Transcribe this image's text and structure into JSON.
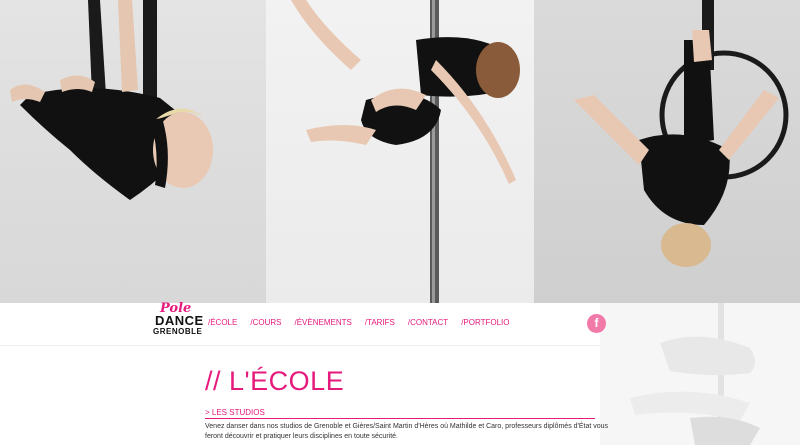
{
  "logo": {
    "word1": "Pole",
    "word2": "DANCE",
    "word3": "GRENOBLE"
  },
  "nav": {
    "items": [
      {
        "label": "/ÉCOLE"
      },
      {
        "label": "/COURS"
      },
      {
        "label": "/ÉVÈNEMENTS"
      },
      {
        "label": "/TARIFS"
      },
      {
        "label": "/CONTACT"
      },
      {
        "label": "/PORTFOLIO"
      }
    ],
    "facebook_glyph": "f"
  },
  "main": {
    "title": "// L'ÉCOLE",
    "section_heading": "> LES STUDIOS",
    "paragraph": "Venez danser dans nos studios de Grenoble et Gières/Saint Martin d'Hères où Mathilde et Caro, professeurs diplômés d'État vous feront découvrir et pratiquer leurs disciplines en toute sécurité."
  },
  "colors": {
    "accent": "#e6197c",
    "facebook_bg": "#f27aa8",
    "text": "#333333"
  },
  "icons": {
    "facebook": "facebook-icon"
  }
}
